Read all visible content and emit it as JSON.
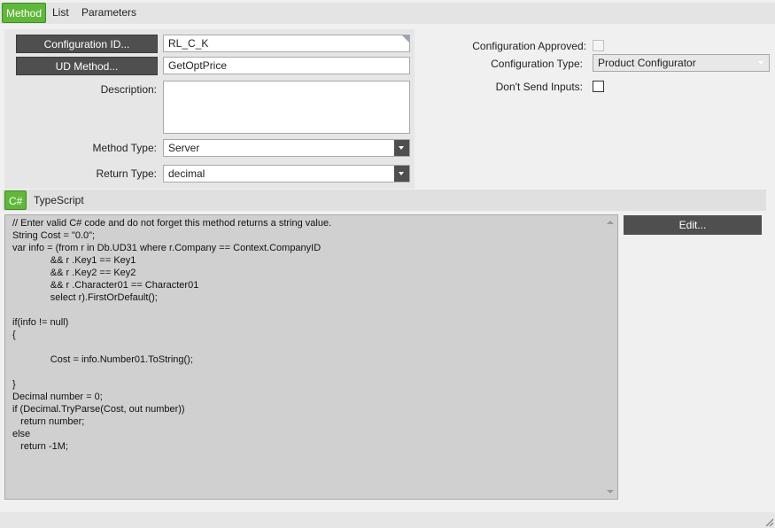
{
  "tabs": [
    {
      "label": "Method",
      "active": true
    },
    {
      "label": "List",
      "active": false
    },
    {
      "label": "Parameters",
      "active": false
    }
  ],
  "form": {
    "config_id_button": "Configuration ID...",
    "config_id_value": "RL_C_K",
    "ud_method_button": "UD Method...",
    "ud_method_value": "GetOptPrice",
    "description_label": "Description:",
    "description_value": "",
    "method_type_label": "Method Type:",
    "method_type_value": "Server",
    "return_type_label": "Return Type:",
    "return_type_value": "decimal"
  },
  "right": {
    "approved_label": "Configuration Approved:",
    "approved_checked": false,
    "config_type_label": "Configuration Type:",
    "config_type_value": "Product Configurator",
    "dont_send_label": "Don't Send Inputs:",
    "dont_send_checked": false
  },
  "code_tabs": [
    {
      "label": "C#",
      "active": true
    },
    {
      "label": "TypeScript",
      "active": false
    }
  ],
  "code_lines": [
    "// Enter valid C# code and do not forget this method returns a string value.",
    "String Cost = \"0.0\";",
    "var info = (from r in Db.UD31 where r.Company == Context.CompanyID",
    "              && r .Key1 == Key1",
    "              && r .Key2 == Key2",
    "              && r .Character01 == Character01",
    "              select r).FirstOrDefault();",
    "",
    "if(info != null)",
    "{",
    "",
    "              Cost = info.Number01.ToString();",
    "",
    "}",
    "Decimal number = 0;",
    "if (Decimal.TryParse(Cost, out number))",
    "   return number;",
    "else",
    "   return -1M;"
  ],
  "edit_button": "Edit...",
  "colors": {
    "accent_green": "#5fb83a",
    "dark_button": "#4f4f4f",
    "code_bg": "#d0d0d0"
  }
}
